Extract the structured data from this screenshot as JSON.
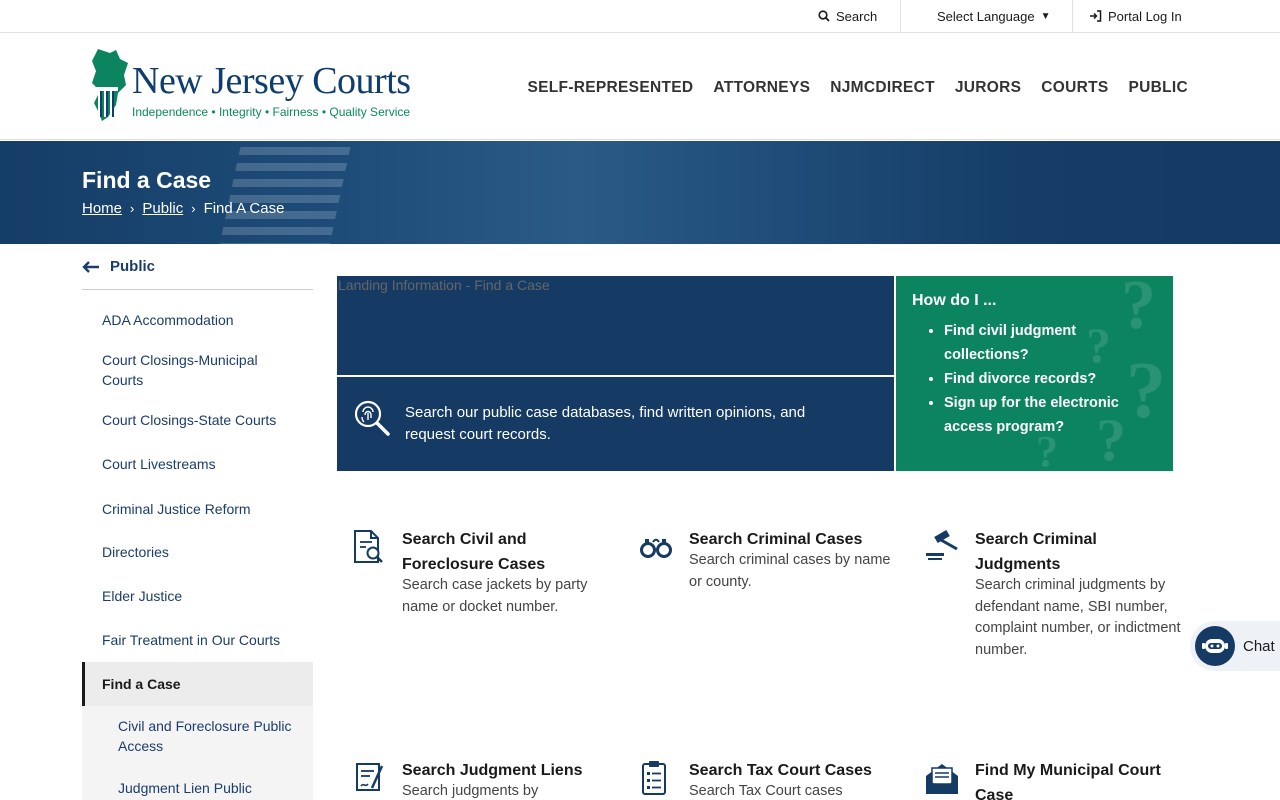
{
  "utility": {
    "search_label": "Search",
    "language_label": "Select Language",
    "language_caret": "▼",
    "portal_label": "Portal Log In"
  },
  "logo": {
    "name": "New Jersey Courts",
    "tagline": "Independence • Integrity • Fairness • Quality Service"
  },
  "nav": [
    "SELF-REPRESENTED",
    "ATTORNEYS",
    "NJMCDIRECT",
    "JURORS",
    "COURTS",
    "PUBLIC"
  ],
  "banner": {
    "title": "Find a Case",
    "breadcrumb": [
      "Home",
      "Public",
      "Find A Case"
    ],
    "sep": "›"
  },
  "sidebar": {
    "back_label": "Public",
    "items": [
      "ADA Accommodation",
      "Court Closings-Municipal Courts",
      "Court Closings-State Courts",
      "Court Livestreams",
      "Criminal Justice Reform",
      "Directories",
      "Elder Justice",
      "Fair Treatment in Our Courts",
      "Find a Case"
    ],
    "subitems": [
      "Civil and Foreclosure Public Access",
      "Judgment Lien Public Access"
    ]
  },
  "hero": {
    "image_alt": "Landing Information - Find a Case",
    "text": "Search our public case databases, find written opinions, and request court records."
  },
  "howdo": {
    "title": "How do I ...",
    "items": [
      "Find civil judgment collections?",
      "Find divorce records?",
      "Sign up for the electronic access program?"
    ]
  },
  "cards": [
    {
      "title": "Search Civil and Foreclosure Cases",
      "desc": "Search case jackets by party name or docket number.",
      "icon": "document-search-icon"
    },
    {
      "title": "Search Criminal Cases",
      "desc": "Search criminal cases by name or county.",
      "icon": "handcuffs-icon"
    },
    {
      "title": "Search Criminal Judgments",
      "desc": "Search criminal judgments by defendant name, SBI number, complaint number, or indictment number.",
      "icon": "gavel-icon"
    },
    {
      "title": "Search Judgment Liens",
      "desc": "Search judgments by",
      "icon": "signed-document-icon"
    },
    {
      "title": "Search Tax Court Cases",
      "desc": "Search Tax Court cases",
      "icon": "clipboard-list-icon"
    },
    {
      "title": "Find My Municipal Court Case",
      "desc": "",
      "icon": "envelope-icon"
    }
  ],
  "chat": {
    "label": "Chat"
  },
  "colors": {
    "navy": "#153a64",
    "green": "#0c8460",
    "text": "#333333"
  }
}
